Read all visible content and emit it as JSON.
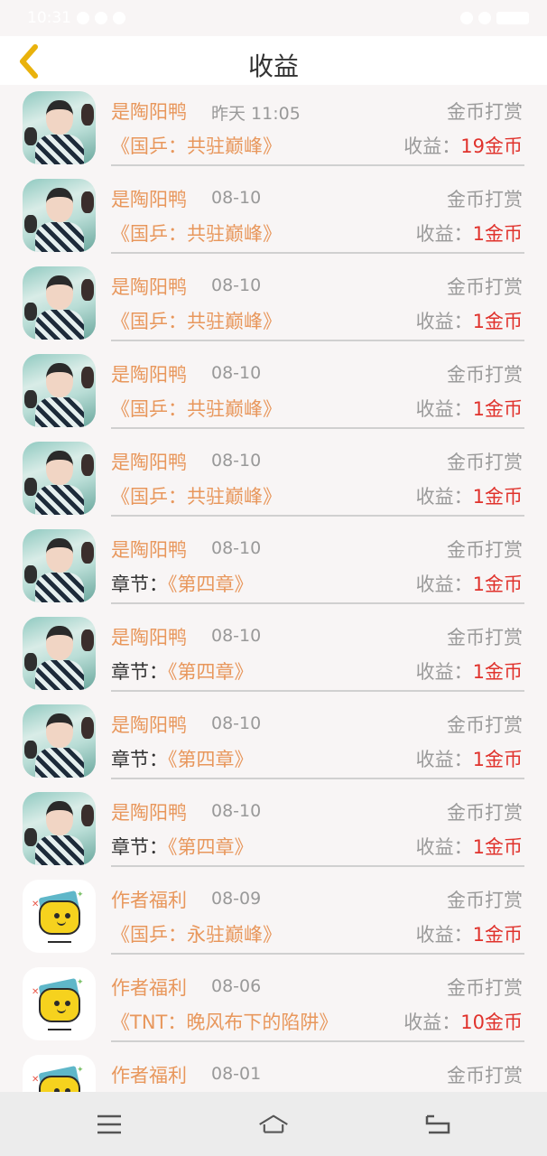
{
  "status_bar": {
    "time": "10:31"
  },
  "header": {
    "title": "收益",
    "back_icon": "chevron-left-icon",
    "back_color": "#e9b20c"
  },
  "items": [
    {
      "avatar": "photo",
      "name": "是陶阳鸭",
      "time": "昨天 11:05",
      "type": "金币打赏",
      "prefix": "",
      "subject": "《国乒：共驻巅峰》",
      "earn_label": "收益：",
      "amount": "19金币"
    },
    {
      "avatar": "photo",
      "name": "是陶阳鸭",
      "time": "08-10",
      "type": "金币打赏",
      "prefix": "",
      "subject": "《国乒：共驻巅峰》",
      "earn_label": "收益：",
      "amount": "1金币"
    },
    {
      "avatar": "photo",
      "name": "是陶阳鸭",
      "time": "08-10",
      "type": "金币打赏",
      "prefix": "",
      "subject": "《国乒：共驻巅峰》",
      "earn_label": "收益：",
      "amount": "1金币"
    },
    {
      "avatar": "photo",
      "name": "是陶阳鸭",
      "time": "08-10",
      "type": "金币打赏",
      "prefix": "",
      "subject": "《国乒：共驻巅峰》",
      "earn_label": "收益：",
      "amount": "1金币"
    },
    {
      "avatar": "photo",
      "name": "是陶阳鸭",
      "time": "08-10",
      "type": "金币打赏",
      "prefix": "",
      "subject": "《国乒：共驻巅峰》",
      "earn_label": "收益：",
      "amount": "1金币"
    },
    {
      "avatar": "photo",
      "name": "是陶阳鸭",
      "time": "08-10",
      "type": "金币打赏",
      "prefix": "章节：",
      "subject": "《第四章》",
      "earn_label": "收益：",
      "amount": "1金币"
    },
    {
      "avatar": "photo",
      "name": "是陶阳鸭",
      "time": "08-10",
      "type": "金币打赏",
      "prefix": "章节：",
      "subject": "《第四章》",
      "earn_label": "收益：",
      "amount": "1金币"
    },
    {
      "avatar": "photo",
      "name": "是陶阳鸭",
      "time": "08-10",
      "type": "金币打赏",
      "prefix": "章节：",
      "subject": "《第四章》",
      "earn_label": "收益：",
      "amount": "1金币"
    },
    {
      "avatar": "photo",
      "name": "是陶阳鸭",
      "time": "08-10",
      "type": "金币打赏",
      "prefix": "章节：",
      "subject": "《第四章》",
      "earn_label": "收益：",
      "amount": "1金币"
    },
    {
      "avatar": "logo",
      "name": "作者福利",
      "time": "08-09",
      "type": "金币打赏",
      "prefix": "",
      "subject": "《国乒：永驻巅峰》",
      "earn_label": "收益：",
      "amount": "1金币"
    },
    {
      "avatar": "logo",
      "name": "作者福利",
      "time": "08-06",
      "type": "金币打赏",
      "prefix": "",
      "subject": "《TNT：晚风布下的陷阱》",
      "earn_label": "收益：",
      "amount": "10金币"
    },
    {
      "avatar": "logo",
      "name": "作者福利",
      "time": "08-01",
      "type": "金币打赏",
      "prefix": "",
      "subject": "",
      "earn_label": "",
      "amount": ""
    }
  ],
  "bottom_nav": {
    "menu_icon": "menu-icon",
    "home_icon": "home-icon",
    "back_icon": "return-icon"
  },
  "colors": {
    "name": "#e8975c",
    "amount": "#e0322c",
    "muted": "#9a9a9a"
  }
}
